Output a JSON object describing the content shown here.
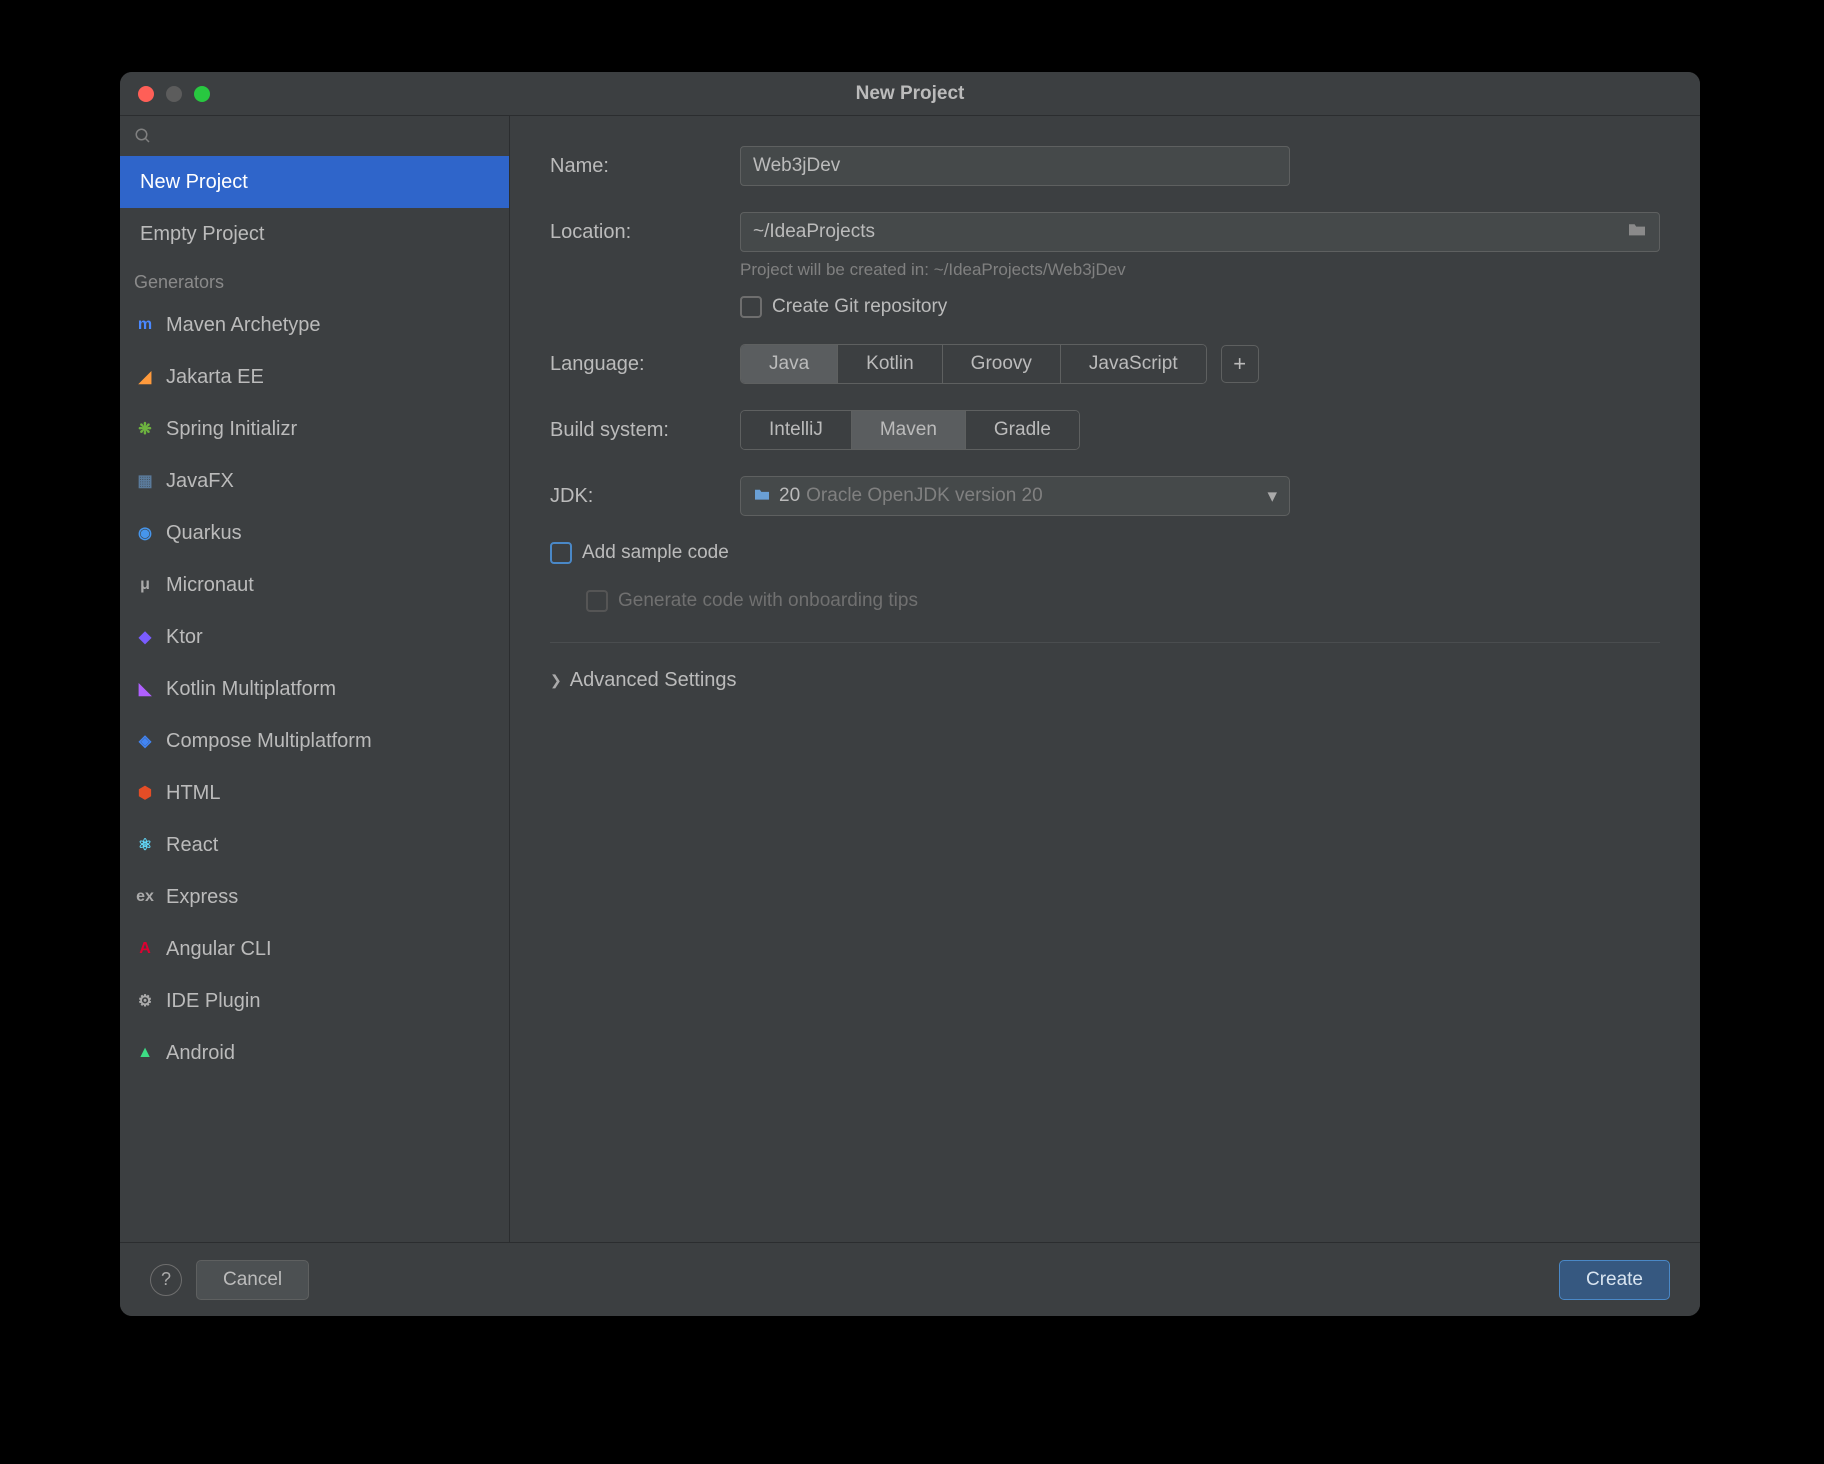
{
  "window": {
    "title": "New Project"
  },
  "sidebar": {
    "items": [
      {
        "label": "New Project",
        "selected": true
      },
      {
        "label": "Empty Project",
        "selected": false
      }
    ],
    "generators_header": "Generators",
    "generators": [
      {
        "label": "Maven Archetype",
        "icon": "m",
        "color": "#4a88ff"
      },
      {
        "label": "Jakarta EE",
        "icon": "◢",
        "color": "#ff9a3c"
      },
      {
        "label": "Spring Initializr",
        "icon": "❋",
        "color": "#6db33f"
      },
      {
        "label": "JavaFX",
        "icon": "▦",
        "color": "#5a7a9a"
      },
      {
        "label": "Quarkus",
        "icon": "◉",
        "color": "#4695eb"
      },
      {
        "label": "Micronaut",
        "icon": "μ",
        "color": "#aaaaaa"
      },
      {
        "label": "Ktor",
        "icon": "◆",
        "color": "#7a5cff"
      },
      {
        "label": "Kotlin Multiplatform",
        "icon": "◣",
        "color": "#b060ff"
      },
      {
        "label": "Compose Multiplatform",
        "icon": "◈",
        "color": "#4285f4"
      },
      {
        "label": "HTML",
        "icon": "⬢",
        "color": "#e44d26"
      },
      {
        "label": "React",
        "icon": "⚛",
        "color": "#61dafb"
      },
      {
        "label": "Express",
        "icon": "ex",
        "color": "#aaaaaa"
      },
      {
        "label": "Angular CLI",
        "icon": "A",
        "color": "#dd0031"
      },
      {
        "label": "IDE Plugin",
        "icon": "⚙",
        "color": "#aaaaaa"
      },
      {
        "label": "Android",
        "icon": "▲",
        "color": "#3ddc84"
      }
    ]
  },
  "form": {
    "name_label": "Name:",
    "name_value": "Web3jDev",
    "location_label": "Location:",
    "location_value": "~/IdeaProjects",
    "location_hint": "Project will be created in: ~/IdeaProjects/Web3jDev",
    "git_label": "Create Git repository",
    "language_label": "Language:",
    "languages": [
      "Java",
      "Kotlin",
      "Groovy",
      "JavaScript"
    ],
    "language_selected": "Java",
    "build_label": "Build system:",
    "builds": [
      "IntelliJ",
      "Maven",
      "Gradle"
    ],
    "build_selected": "Maven",
    "jdk_label": "JDK:",
    "jdk_value": "20",
    "jdk_detail": "Oracle OpenJDK version 20",
    "sample_label": "Add sample code",
    "onboarding_label": "Generate code with onboarding tips",
    "advanced_label": "Advanced Settings"
  },
  "footer": {
    "cancel": "Cancel",
    "create": "Create"
  }
}
